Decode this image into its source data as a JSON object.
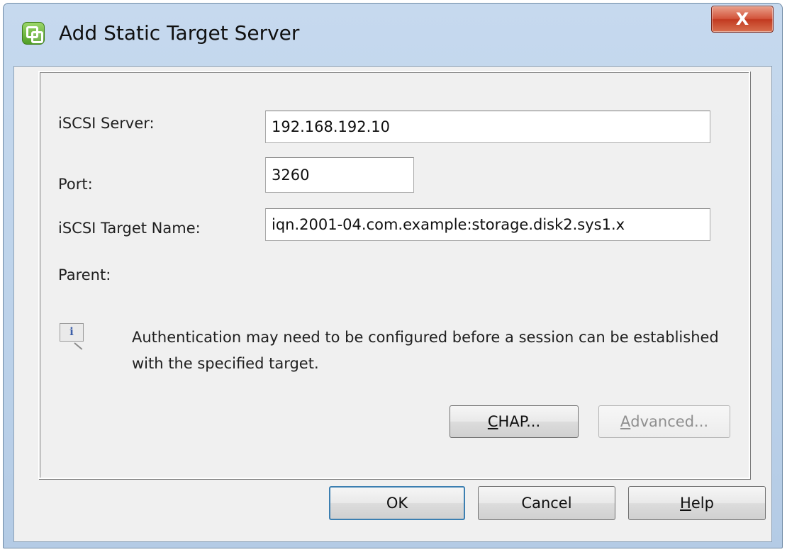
{
  "window": {
    "title": "Add Static Target Server",
    "close_glyph": "X",
    "icon": "vsphere-client-icon"
  },
  "form": {
    "server_label": "iSCSI Server:",
    "server_value": "192.168.192.10",
    "port_label": "Port:",
    "port_value": "3260",
    "target_label": "iSCSI Target Name:",
    "target_value": "iqn.2001-04.com.example:storage.disk2.sys1.x",
    "parent_label": "Parent:"
  },
  "info": {
    "icon": "info-icon",
    "glyph": "i",
    "message": "Authentication may need to be configured before a session can be established with the specified target."
  },
  "buttons": {
    "chap": {
      "mnemonic": "C",
      "rest": "HAP..."
    },
    "advanced": {
      "mnemonic": "A",
      "rest": "dvanced..."
    },
    "ok": "OK",
    "cancel": "Cancel",
    "help": {
      "mnemonic": "H",
      "rest": "elp"
    }
  },
  "colors": {
    "close_button": "#c9452c",
    "dialog_face": "#f0f0f0",
    "frame": "#bcd2ea"
  }
}
